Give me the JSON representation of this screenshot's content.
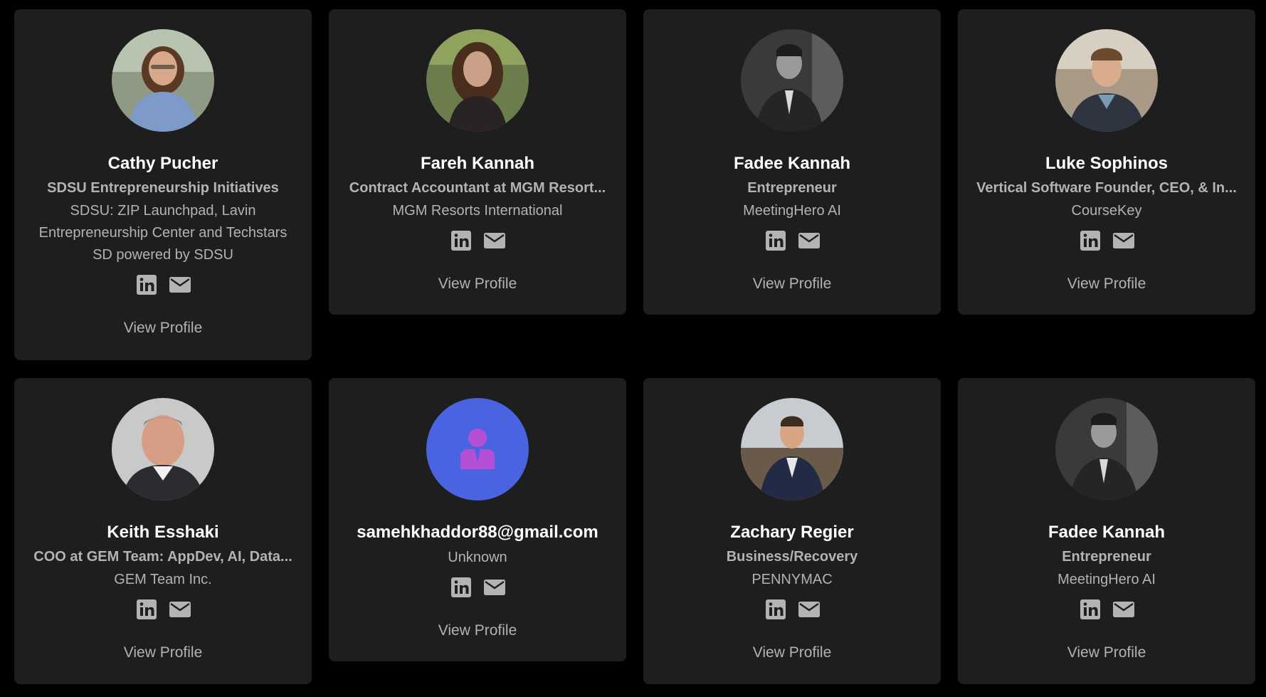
{
  "people": [
    {
      "name": "Cathy Pucher",
      "title": "SDSU Entrepreneurship Initiatives",
      "company": "SDSU: ZIP Launchpad, Lavin Entrepreneurship Center and Techstars SD powered by SDSU",
      "avatar": "photo",
      "view_label": "View Profile"
    },
    {
      "name": "Fareh Kannah",
      "title": "Contract Accountant at MGM Resort...",
      "company": "MGM Resorts International",
      "avatar": "photo",
      "view_label": "View Profile"
    },
    {
      "name": "Fadee Kannah",
      "title": "Entrepreneur",
      "company": "MeetingHero AI",
      "avatar": "photo",
      "view_label": "View Profile"
    },
    {
      "name": "Luke Sophinos",
      "title": "Vertical Software Founder, CEO, & In...",
      "company": "CourseKey",
      "avatar": "photo",
      "view_label": "View Profile"
    },
    {
      "name": "Keith Esshaki",
      "title": "COO at GEM Team: AppDev, AI, Data...",
      "company": "GEM Team Inc.",
      "avatar": "photo",
      "view_label": "View Profile"
    },
    {
      "name": "samehkhaddor88@gmail.com",
      "title": "",
      "company": "Unknown",
      "avatar": "placeholder-person-icon",
      "view_label": "View Profile"
    },
    {
      "name": "Zachary Regier",
      "title": "Business/Recovery",
      "company": "PENNYMAC",
      "avatar": "photo",
      "view_label": "View Profile"
    },
    {
      "name": "Fadee Kannah",
      "title": "Entrepreneur",
      "company": "MeetingHero AI",
      "avatar": "photo",
      "view_label": "View Profile"
    }
  ],
  "icons": {
    "linkedin": "linkedin-icon",
    "email": "email-icon"
  },
  "colors": {
    "background": "#000000",
    "card": "#1e1e1f",
    "name_text": "#ffffff",
    "secondary_text": "#b3b3b3",
    "placeholder_avatar": "#4a63e0",
    "placeholder_figure": "#b44fd6"
  }
}
